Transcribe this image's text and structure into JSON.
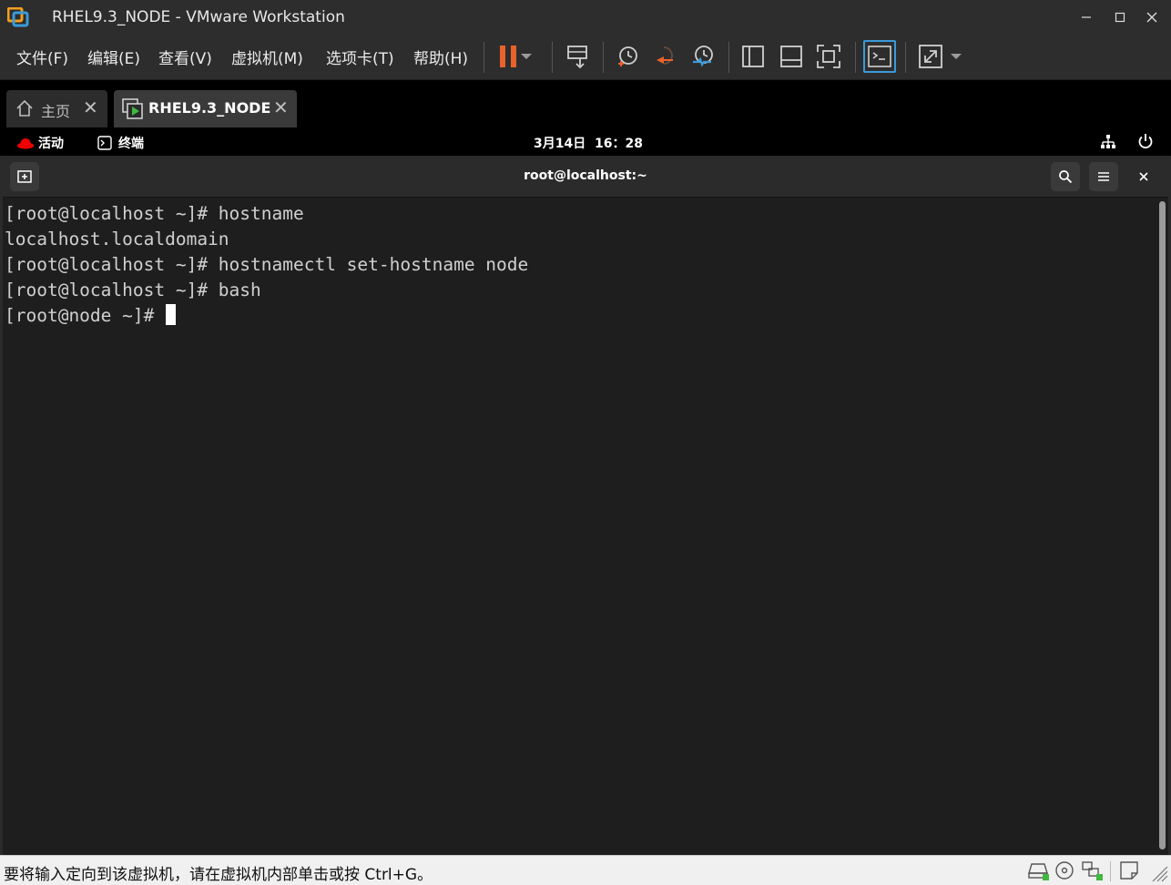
{
  "window": {
    "title": "RHEL9.3_NODE - VMware Workstation"
  },
  "menu": {
    "items": [
      "文件(F)",
      "编辑(E)",
      "查看(V)",
      "虚拟机(M)",
      "选项卡(T)",
      "帮助(H)"
    ]
  },
  "toolbar": {
    "icons": [
      "pause-icon",
      "dropdown-arrow-icon",
      "send-ctrl-alt-del-icon",
      "snapshot-icon",
      "revert-snapshot-icon",
      "snapshot-manager-icon",
      "sidebar-icon",
      "thumbnail-icon",
      "fullscreen-icon",
      "console-view-icon",
      "stretch-icon"
    ]
  },
  "tabs": [
    {
      "label": "主页",
      "icon": "home-icon",
      "active": false
    },
    {
      "label": "RHEL9.3_NODE",
      "icon": "vm-running-icon",
      "active": true
    }
  ],
  "gnome": {
    "activities": "活动",
    "app": "终端",
    "clock": "3月14日  16：28"
  },
  "terminal": {
    "title": "root@localhost:~",
    "lines": [
      "[root@localhost ~]# hostname",
      "localhost.localdomain",
      "[root@localhost ~]# hostnamectl set-hostname node",
      "[root@localhost ~]# bash",
      "[root@node ~]# "
    ]
  },
  "status": {
    "text": "要将输入定向到该虚拟机，请在虚拟机内部单击或按 Ctrl+G。"
  },
  "colors": {
    "accent_orange": "#e8622c",
    "terminal_bg": "#1e1e1e",
    "status_green": "#3fb93f"
  }
}
